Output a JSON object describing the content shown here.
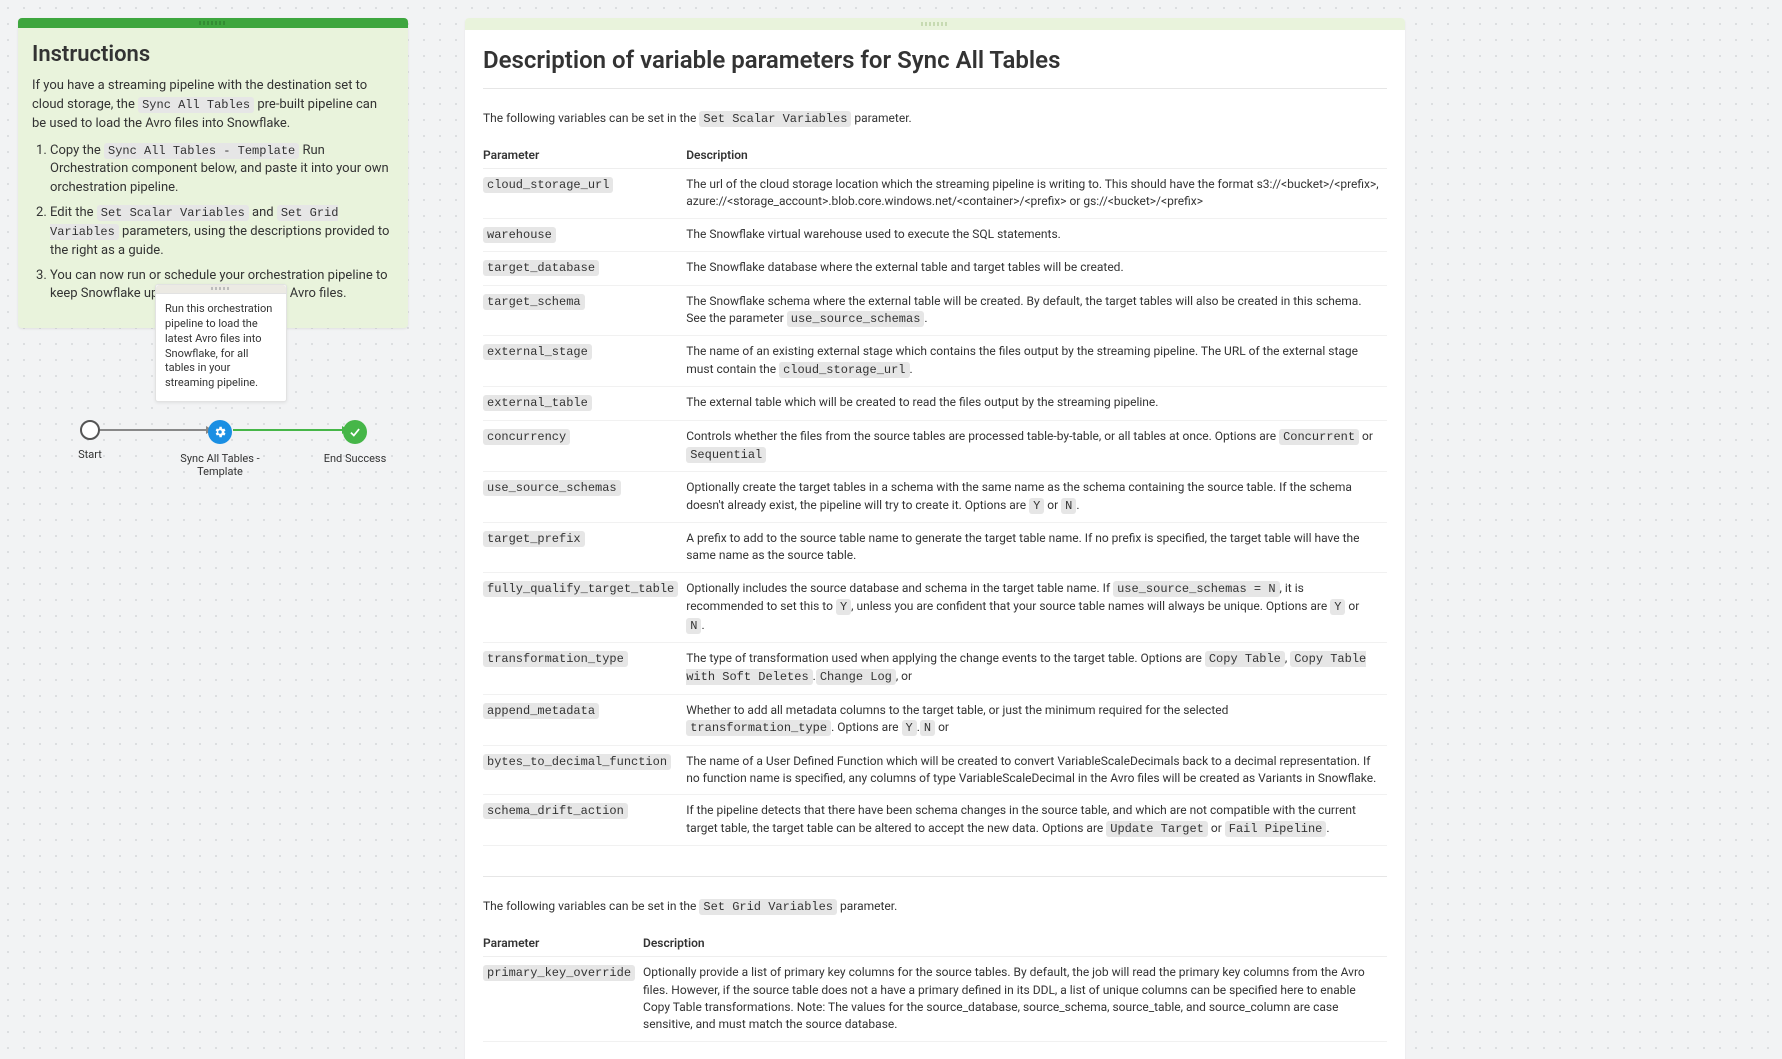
{
  "instructions": {
    "title": "Instructions",
    "intro_pre": "If you have a streaming pipeline with the destination set to cloud storage, the ",
    "intro_code": "Sync All Tables",
    "intro_post": " pre-built pipeline can be used to load the Avro files into Snowflake.",
    "steps": [
      {
        "pre": "Copy the ",
        "code": "Sync All Tables - Template",
        "post": " Run Orchestration component below, and paste it into your own orchestration pipeline."
      },
      {
        "pre": "Edit the ",
        "code": "Set Scalar Variables",
        "mid": " and ",
        "code2": "Set Grid Variables",
        "post": " parameters, using the descriptions provided to the right as a guide."
      },
      {
        "pre": "You can now run or schedule your orchestration pipeline to keep Snowflake up to date with the latest Avro files."
      }
    ]
  },
  "diagram": {
    "note": "Run this orchestration pipeline to load the latest Avro files into Snowflake, for all tables in your streaming pipeline.",
    "start": "Start",
    "mid": "Sync All Tables - Template",
    "end": "End Success"
  },
  "doc": {
    "title": "Description of variable parameters for Sync All Tables",
    "scalar_lead_pre": "The following variables can be set in the ",
    "scalar_lead_code": "Set Scalar Variables",
    "scalar_lead_post": " parameter.",
    "col_param": "Parameter",
    "col_desc": "Description",
    "scalar_rows": [
      {
        "name": "cloud_storage_url",
        "desc": "The url of the cloud storage location which the streaming pipeline is writing to. This should have the format s3://<bucket>/<prefix>, azure://<storage_account>.blob.core.windows.net/<container>/<prefix> or gs://<bucket>/<prefix>"
      },
      {
        "name": "warehouse",
        "desc": "The Snowflake virtual warehouse used to execute the SQL statements."
      },
      {
        "name": "target_database",
        "desc": "The Snowflake database where the external table and target tables will be created."
      },
      {
        "name": "target_schema",
        "desc_pre": "The Snowflake schema where the external table will be created. By default, the target tables will also be created in this schema. See the parameter ",
        "code": "use_source_schemas",
        "desc_post": "."
      },
      {
        "name": "external_stage",
        "desc_pre": "The name of an existing external stage which contains the files output by the streaming pipeline. The URL of the external stage must contain the ",
        "code": "cloud_storage_url",
        "desc_post": "."
      },
      {
        "name": "external_table",
        "desc": "The external table which will be created to read the files output by the streaming pipeline."
      },
      {
        "name": "concurrency",
        "desc_pre": "Controls whether the files from the source tables are processed table-by-table, or all tables at once. Options are ",
        "code": "Concurrent",
        "mid": " or ",
        "code2": "Sequential"
      },
      {
        "name": "use_source_schemas",
        "desc_pre": "Optionally create the target tables in a schema with the same name as the schema containing the source table. If the schema doesn't already exist, the pipeline will try to create it. Options are ",
        "code": "Y",
        "mid": " or ",
        "code2": "N",
        "desc_post": "."
      },
      {
        "name": "target_prefix",
        "desc": "A prefix to add to the source table name to generate the target table name. If no prefix is specified, the target table will have the same name as the source table."
      },
      {
        "name": "fully_qualify_target_table",
        "desc_pre": "Optionally includes the source database and schema in the target table name. If ",
        "code": "use_source_schemas = N",
        "mid": ", it is recommended to set this to ",
        "code2": "Y",
        "desc_post": ", unless you are confident that your source table names will always be unique. Options are ",
        "code3": "Y",
        "mid2": " or ",
        "code4": "N",
        "desc_post2": "."
      },
      {
        "name": "transformation_type",
        "desc_pre": "The type of transformation used when applying the change events to the target table. Options are ",
        "code": "Copy Table",
        "mid": ", ",
        "code2": "Copy Table with Soft Deletes",
        "mid2": ", or ",
        "code3": "Change Log",
        "desc_post": "."
      },
      {
        "name": "append_metadata",
        "desc_pre": "Whether to add all metadata columns to the target table, or just the minimum required for the selected ",
        "code": "transformation_type",
        "mid": ". Options are ",
        "code2": "Y",
        "mid2": " or ",
        "code3": "N",
        "desc_post": "."
      },
      {
        "name": "bytes_to_decimal_function",
        "desc": "The name of a User Defined Function which will be created to convert VariableScaleDecimals back to a decimal representation. If no function name is specified, any columns of type VariableScaleDecimal in the Avro files will be created as Variants in Snowflake."
      },
      {
        "name": "schema_drift_action",
        "desc_pre": "If the pipeline detects that there have been schema changes in the source table, and which are not compatible with the current target table, the target table can be altered to accept the new data. Options are ",
        "code": "Update Target",
        "mid": " or ",
        "code2": "Fail Pipeline",
        "desc_post": "."
      }
    ],
    "grid_lead_pre": "The following variables can be set in the ",
    "grid_lead_code": "Set Grid Variables",
    "grid_lead_post": " parameter.",
    "grid_rows": [
      {
        "name": "primary_key_override",
        "desc": "Optionally provide a list of primary key columns for the source tables. By default, the job will read the primary key columns from the Avro files. However, if the source table does not a have a primary defined in its DDL, a list of unique columns can be specified here to enable Copy Table transformations. Note: The values for the source_database, source_schema, source_table, and source_column are case sensitive, and must match the source database."
      }
    ]
  }
}
